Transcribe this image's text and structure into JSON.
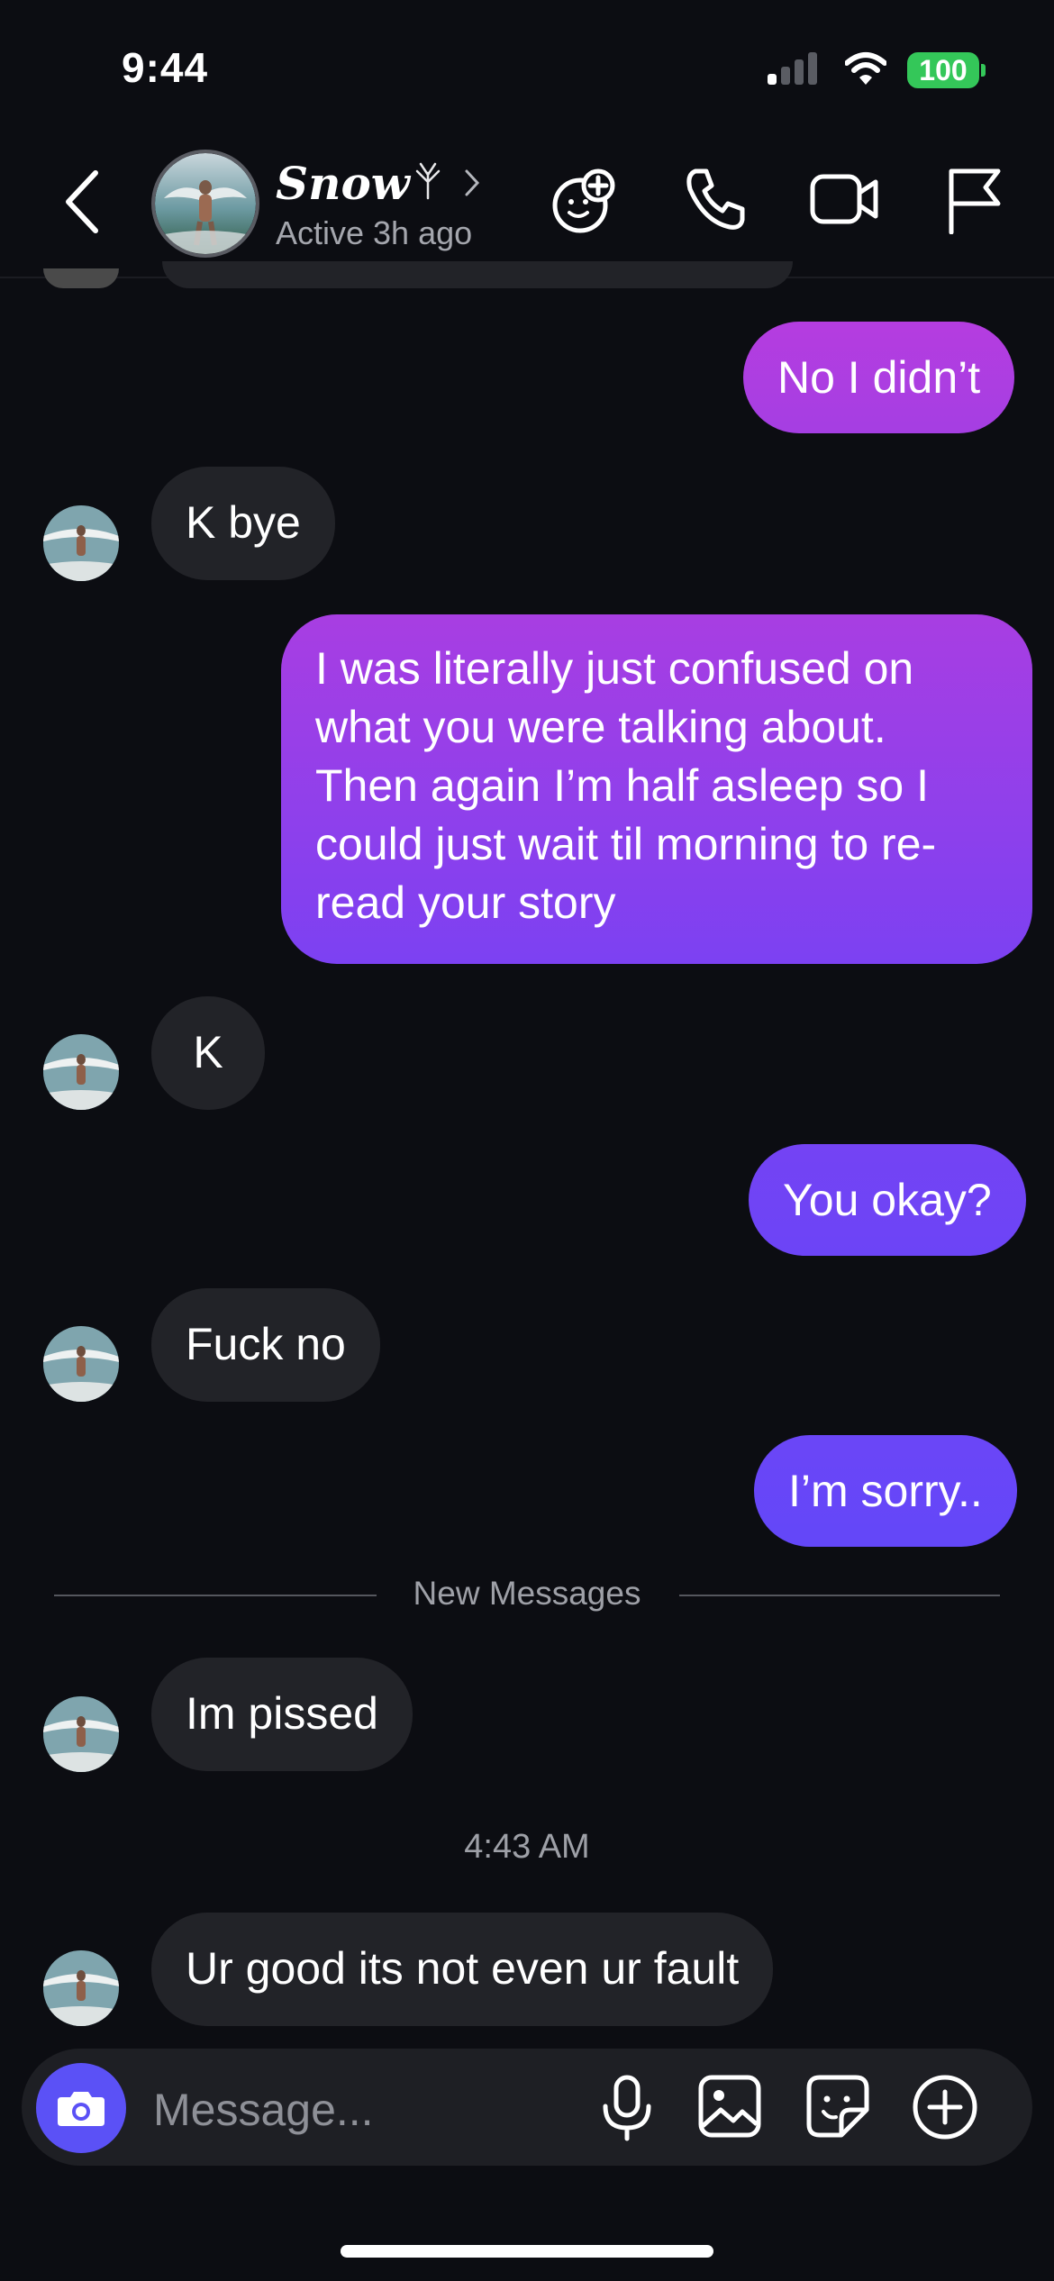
{
  "status_bar": {
    "time": "9:44",
    "battery": "100"
  },
  "header": {
    "contact_name": "Snow",
    "contact_status": "Active 3h ago"
  },
  "messages": [
    {
      "direction": "out",
      "text": "No I didn’t"
    },
    {
      "direction": "in",
      "text": "K bye"
    },
    {
      "direction": "out",
      "lines": [
        "I was literally just confused on",
        "what you were talking about.",
        "Then again I’m half asleep so I",
        "could just wait til morning to re-",
        "read your story"
      ]
    },
    {
      "direction": "in",
      "text": "K"
    },
    {
      "direction": "out",
      "text": "You okay?"
    },
    {
      "direction": "in",
      "text": "Fuck no"
    },
    {
      "direction": "out",
      "text": "I’m sorry.."
    },
    {
      "direction": "in",
      "text": "Im pissed"
    },
    {
      "direction": "in",
      "text": "Ur good its not even ur fault"
    }
  ],
  "new_messages_divider": "New Messages",
  "timestamp": "4:43 AM",
  "composer": {
    "placeholder": "Message..."
  },
  "colors": {
    "background": "#0c0d12",
    "incoming_bubble": "#222328",
    "outgoing_gradient_top": "#b23adf",
    "outgoing_gradient_bottom": "#6a44f7",
    "camera_button": "#5b51f6",
    "battery": "#34c759"
  },
  "icons": [
    "back-chevron-icon",
    "effects-icon",
    "phone-icon",
    "video-camera-icon",
    "flag-icon",
    "camera-icon",
    "microphone-icon",
    "image-icon",
    "sticker-icon",
    "plus-icon",
    "wifi-icon",
    "signal-icon"
  ]
}
